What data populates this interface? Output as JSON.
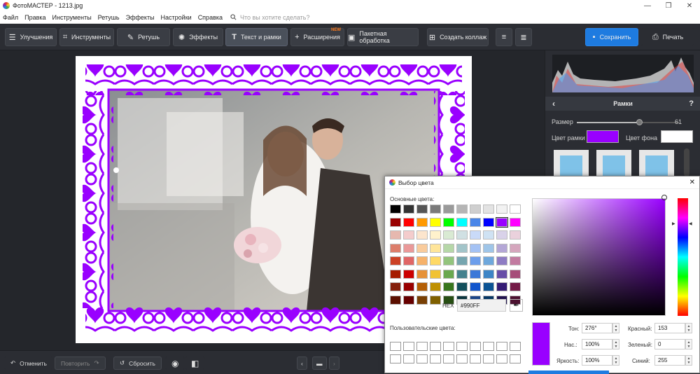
{
  "window": {
    "title": "ФотоМАСТЕР - 1213.jpg"
  },
  "menu": {
    "items": [
      "Файл",
      "Правка",
      "Инструменты",
      "Ретушь",
      "Эффекты",
      "Настройки",
      "Справка"
    ],
    "search_placeholder": "Что вы хотите сделать?"
  },
  "toolbar": {
    "enhance": "Улучшения",
    "tools": "Инструменты",
    "retouch": "Ретушь",
    "effects": "Эффекты",
    "text_frames": "Текст и рамки",
    "extensions": "Расширения",
    "extensions_badge": "NEW",
    "batch": "Пакетная обработка",
    "collage": "Создать коллаж",
    "save": "Сохранить",
    "print": "Печать"
  },
  "bottom": {
    "undo": "Отменить",
    "redo": "Повторить",
    "reset": "Сбросить"
  },
  "panel": {
    "title": "Рамки",
    "help": "?",
    "size_label": "Размер",
    "size_value": "61",
    "size_fraction": 0.61,
    "frame_color_label": "Цвет рамки",
    "frame_color": "#990FF",
    "bg_color_label": "Цвет фона",
    "bg_color": "#ffffff"
  },
  "dialog": {
    "title": "Выбор цвета",
    "basic_colors_label": "Основные цвета:",
    "custom_colors_label": "Пользовательские цвета:",
    "hex_label": "HEX",
    "hex_value": "#990FF",
    "hue_label": "Тон:",
    "hue_value": "276°",
    "sat_label": "Нас.:",
    "sat_value": "100%",
    "bri_label": "Яркость:",
    "bri_value": "100%",
    "red_label": "Красный:",
    "red_value": "153",
    "green_label": "Зеленый:",
    "green_value": "0",
    "blue_label": "Синий:",
    "blue_value": "255",
    "accent": "#9900ff",
    "basic_colors": [
      [
        "#000000",
        "#333333",
        "#555555",
        "#7a7a7a",
        "#9a9a9a",
        "#b5b5b5",
        "#cfcfcf",
        "#e3e3e3",
        "#f2f2f2",
        "#ffffff"
      ],
      [
        "#990000",
        "#ff0000",
        "#ff9900",
        "#ffff00",
        "#00ff00",
        "#00ffff",
        "#4a86e8",
        "#0000ff",
        "#9900ff",
        "#ff00ff"
      ],
      [
        "#e6b8af",
        "#f4cccc",
        "#fce5cd",
        "#fff2cc",
        "#d9ead3",
        "#d0e0e3",
        "#c9daf8",
        "#cfe2f3",
        "#d9d2e9",
        "#ead1dc"
      ],
      [
        "#dd7e6b",
        "#ea9999",
        "#f9cb9c",
        "#ffe599",
        "#b6d7a8",
        "#a2c4c9",
        "#a4c2f4",
        "#9fc5e8",
        "#b4a7d6",
        "#d5a6bd"
      ],
      [
        "#cc4125",
        "#e06666",
        "#f6b26b",
        "#ffd966",
        "#93c47d",
        "#76a5af",
        "#6d9eeb",
        "#6fa8dc",
        "#8e7cc3",
        "#c27ba0"
      ],
      [
        "#a61c00",
        "#cc0000",
        "#e69138",
        "#f1c232",
        "#6aa84f",
        "#45818e",
        "#3c78d8",
        "#3d85c6",
        "#674ea7",
        "#a64d79"
      ],
      [
        "#85200c",
        "#990000",
        "#b45f06",
        "#bf9000",
        "#38761d",
        "#134f5c",
        "#1155cc",
        "#0b5394",
        "#351c75",
        "#741b47"
      ],
      [
        "#5b0f00",
        "#660000",
        "#783f04",
        "#7f6000",
        "#274e13",
        "#0c343d",
        "#1c4587",
        "#073763",
        "#20124d",
        "#4c1130"
      ]
    ]
  }
}
